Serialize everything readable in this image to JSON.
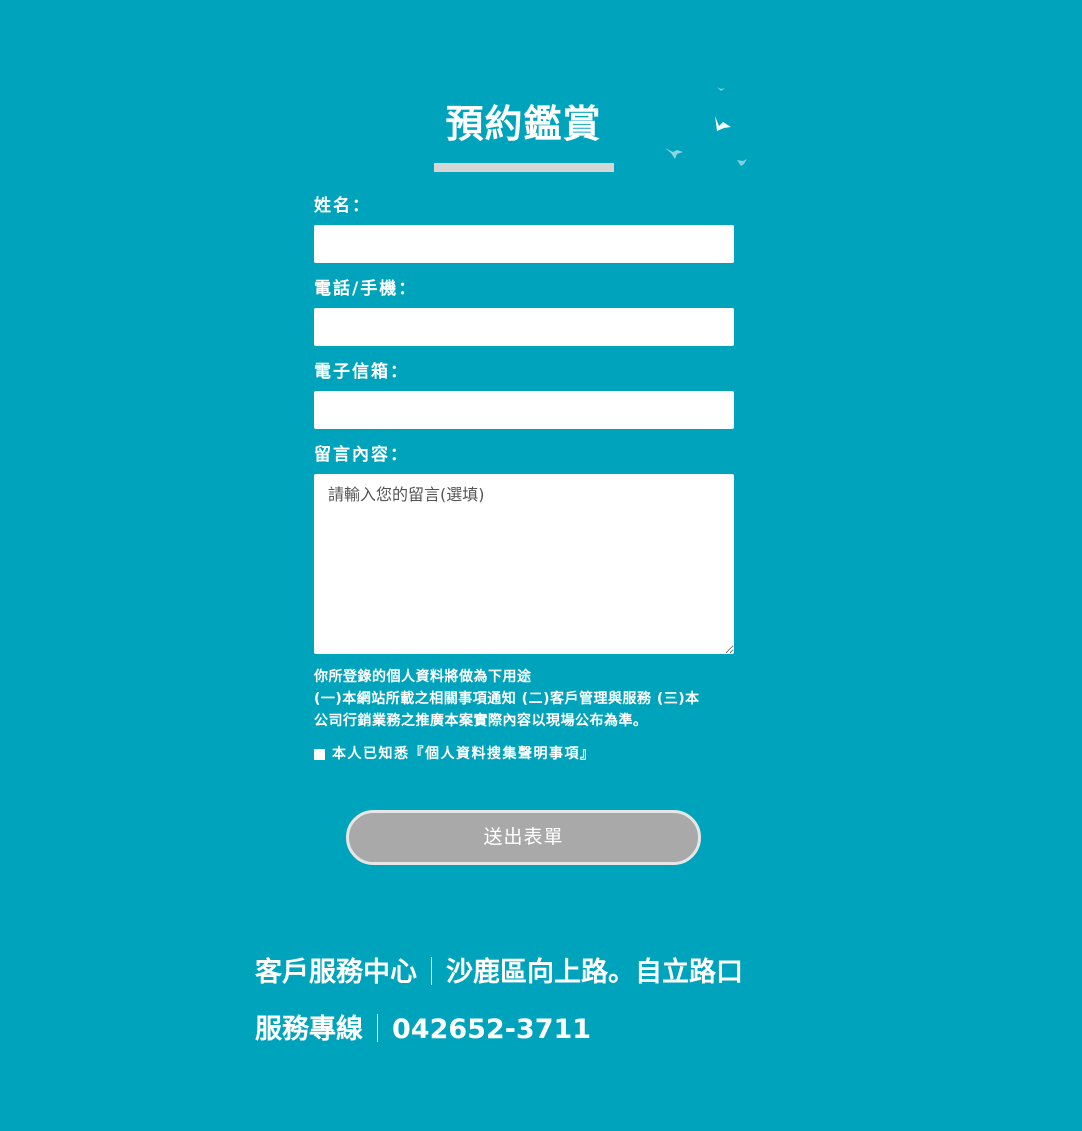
{
  "form": {
    "title": "預約鑑賞",
    "fields": {
      "name_label": "姓名：",
      "phone_label": "電話/手機：",
      "email_label": "電子信箱：",
      "message_label": "留言內容：",
      "message_placeholder": "請輸入您的留言(選填)"
    },
    "notice": {
      "line1": "你所登錄的個人資料將做為下用途",
      "line2": "(一)本網站所載之相關事項通知 (二)客戶管理與服務 (三)本",
      "line3": "公司行銷業務之推廣本案實際內容以現場公布為準。"
    },
    "consent_label": "本人已知悉『個人資料搜集聲明事項』",
    "submit_label": "送出表單"
  },
  "footer": {
    "service_center_label": "客戶服務中心",
    "service_center_address": "沙鹿區向上路。自立路口",
    "hotline_label": "服務專線",
    "hotline_number": "042652-3711"
  },
  "colors": {
    "background": "#00a3bc",
    "submit_button": "#a9a9a9",
    "title_underline": "#d6d6d6"
  },
  "icons": [
    "bird-icon"
  ]
}
